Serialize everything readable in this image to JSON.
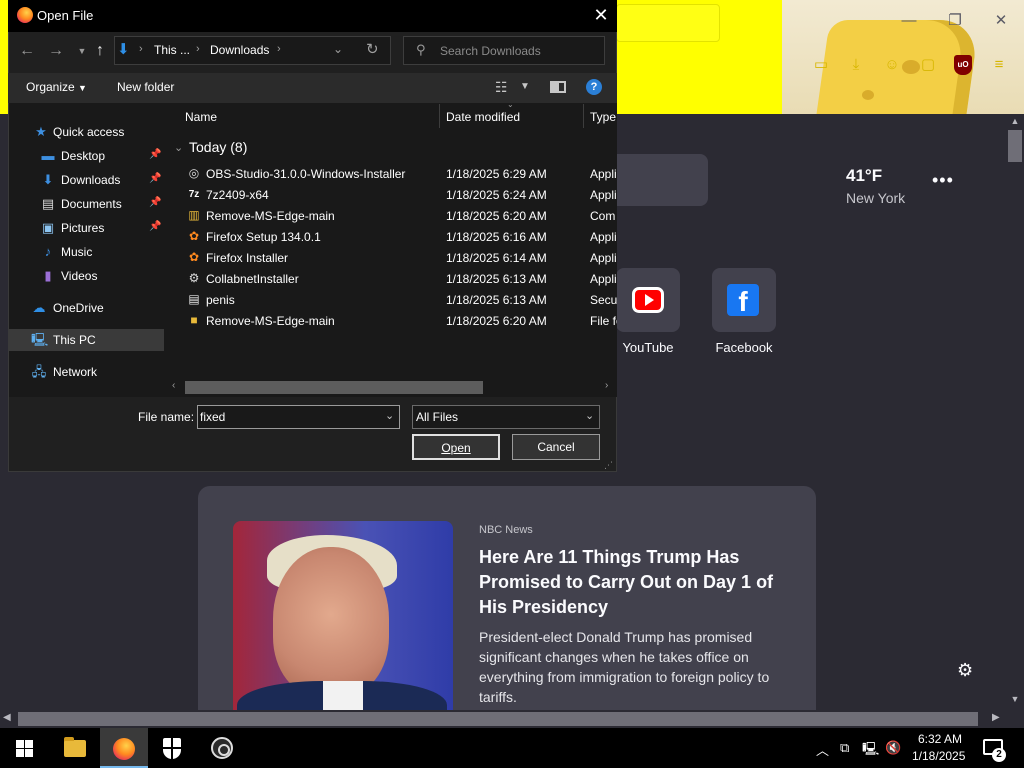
{
  "dialog": {
    "title": "Open File",
    "address": {
      "crumbs": [
        "This ...",
        "Downloads"
      ]
    },
    "search": {
      "placeholder": "Search Downloads"
    },
    "toolbar": {
      "organize": "Organize",
      "new_folder": "New folder",
      "help": "?"
    },
    "nav": [
      {
        "label": "Quick access",
        "icon": "star-icon",
        "pinned": false
      },
      {
        "label": "Desktop",
        "icon": "desktop-icon",
        "pinned": true
      },
      {
        "label": "Downloads",
        "icon": "download-icon",
        "pinned": true
      },
      {
        "label": "Documents",
        "icon": "document-icon",
        "pinned": true
      },
      {
        "label": "Pictures",
        "icon": "pictures-icon",
        "pinned": true
      },
      {
        "label": "Music",
        "icon": "music-icon",
        "pinned": false
      },
      {
        "label": "Videos",
        "icon": "videos-icon",
        "pinned": false
      },
      {
        "label": "OneDrive",
        "icon": "cloud-icon",
        "pinned": false
      },
      {
        "label": "This PC",
        "icon": "computer-icon",
        "pinned": false,
        "selected": true
      },
      {
        "label": "Network",
        "icon": "network-icon",
        "pinned": false
      }
    ],
    "columns": {
      "name": "Name",
      "date": "Date modified",
      "type": "Type"
    },
    "group_label": "Today (8)",
    "files": [
      {
        "name": "OBS-Studio-31.0.0-Windows-Installer",
        "date": "1/18/2025 6:29 AM",
        "type": "Appli",
        "icon": "obs-icon"
      },
      {
        "name": "7z2409-x64",
        "date": "1/18/2025 6:24 AM",
        "type": "Appli",
        "icon": "7zip-icon"
      },
      {
        "name": "Remove-MS-Edge-main",
        "date": "1/18/2025 6:20 AM",
        "type": "Com",
        "icon": "zip-folder-icon"
      },
      {
        "name": "Firefox Setup 134.0.1",
        "date": "1/18/2025 6:16 AM",
        "type": "Appli",
        "icon": "firefox-setup-icon"
      },
      {
        "name": "Firefox Installer",
        "date": "1/18/2025 6:14 AM",
        "type": "Appli",
        "icon": "firefox-installer-icon"
      },
      {
        "name": "CollabnetInstaller",
        "date": "1/18/2025 6:13 AM",
        "type": "Appli",
        "icon": "installer-icon"
      },
      {
        "name": "penis",
        "date": "1/18/2025 6:13 AM",
        "type": "Secur",
        "icon": "certificate-icon"
      },
      {
        "name": "Remove-MS-Edge-main",
        "date": "1/18/2025 6:20 AM",
        "type": "File fo",
        "icon": "folder-icon"
      }
    ],
    "file_name_label": "File name:",
    "file_name_value": "fixed",
    "file_type_value": "All Files",
    "open_label": "Open",
    "cancel_label": "Cancel"
  },
  "browser": {
    "weather": {
      "temp": "41°F",
      "city": "New York",
      "more": "•••"
    },
    "shortcuts": [
      {
        "label": "YouTube"
      },
      {
        "label": "Facebook"
      }
    ],
    "news": {
      "source": "NBC News",
      "title": "Here Are 11 Things Trump Has Promised to Carry Out on Day 1 of His Presidency",
      "description": "President-elect Donald Trump has promised significant changes when he takes office on everything from immigration to foreign policy to tariffs."
    },
    "theme_color": "#ffff00"
  },
  "taskbar": {
    "time": "6:32 AM",
    "date": "1/18/2025",
    "notification_count": "2",
    "apps": [
      "start",
      "file-explorer",
      "firefox",
      "windows-security",
      "obs-studio"
    ]
  }
}
